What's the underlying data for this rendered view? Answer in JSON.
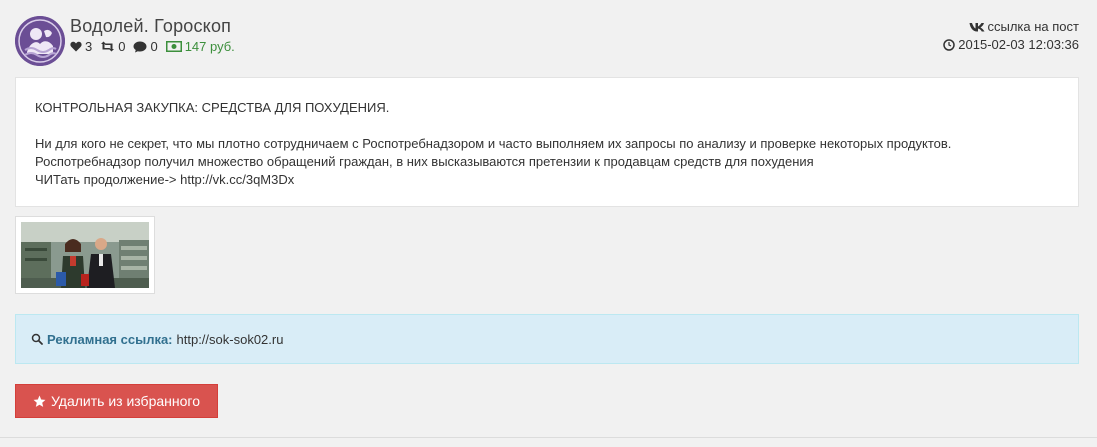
{
  "post": {
    "author": "Водолей. Гороскоп",
    "stats": {
      "likes": "3",
      "reposts": "0",
      "comments": "0",
      "price": "147 руб."
    },
    "link_label": "ссылка на пост",
    "datetime": "2015-02-03 12:03:36",
    "text": {
      "title": "КОНТРОЛЬНАЯ ЗАКУПКА: СРЕДСТВА ДЛЯ ПОХУДЕНИЯ.",
      "line1": "Ни для кого не секрет, что мы плотно сотрудничаем с Роспотребнадзором и часто выполняем их запросы по анализу и проверке некоторых продуктов.",
      "line2": "Роспотребнадзор получил множество обращений граждан, в них высказываются претензии к продавцам средств для похудения",
      "line3": "ЧИТать продолжение-> http://vk.cc/3qM3Dx"
    },
    "ad": {
      "label": "Рекламная ссылка:",
      "url": "http://sok-sok02.ru"
    },
    "remove_button": "Удалить из избранного"
  },
  "icons": {
    "likes": "heart-icon",
    "reposts": "retweet-icon",
    "comments": "comment-icon",
    "price": "money-icon",
    "link": "vk-icon",
    "datetime": "clock-icon",
    "ad": "search-icon",
    "remove": "star-icon"
  },
  "colors": {
    "background": "#f1f1f1",
    "ad_background": "#d9edf7",
    "ad_label": "#31708f",
    "money": "#3c8f3c",
    "danger_button": "#d9534f"
  }
}
